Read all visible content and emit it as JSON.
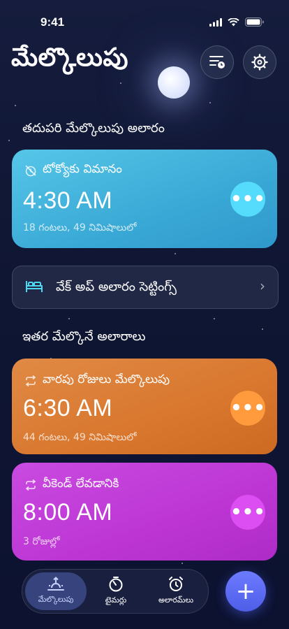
{
  "status_bar": {
    "time": "9:41"
  },
  "header": {
    "title": "మేల్కొలుపు",
    "alarm_list_button": "alarm-list-icon",
    "settings_button": "settings-gear-icon"
  },
  "next_alarm": {
    "section_title": "తదుపరి మేల్కొలుపు అలారం",
    "label": "టోక్యోకు విమానం",
    "time": "4:30 AM",
    "remaining": "18 గంటలు, 49 నిమిషాలులో",
    "color": "#3fb0d8"
  },
  "wake_settings": {
    "label": "వేక్ అప్ అలారం సెట్టింగ్స్"
  },
  "other_alarms": {
    "section_title": "ఇతర మేల్కొనే అలారాలు",
    "items": [
      {
        "label": "వారపు రోజులు మేల్కొలుపు",
        "time": "6:30 AM",
        "remaining": "44 గంటలు, 49 నిమిషాలులో",
        "color": "#de7a2e"
      },
      {
        "label": "వీకెండ్ లేవడానికి",
        "time": "8:00 AM",
        "remaining": "3 రోజుల్లో",
        "color": "#c23fd8"
      }
    ]
  },
  "tabbar": {
    "tabs": [
      {
        "label": "మేల్కొలుపు",
        "icon": "sunrise-icon",
        "active": true
      },
      {
        "label": "టైమర్లు",
        "icon": "timer-icon",
        "active": false
      },
      {
        "label": "అలారమ్‌లు",
        "icon": "alarm-clock-icon",
        "active": false
      }
    ],
    "add_button": "+"
  }
}
